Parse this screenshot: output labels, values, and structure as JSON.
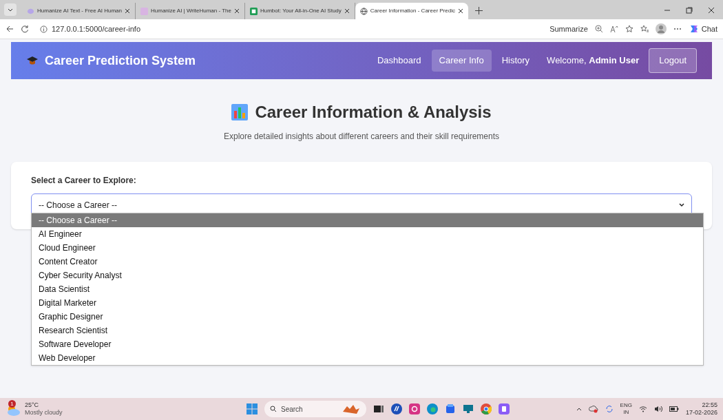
{
  "browser": {
    "tabs": [
      {
        "title": "Humanize AI Text - Free AI Human",
        "selected": false
      },
      {
        "title": "Humanize AI | WriteHuman - The",
        "selected": false
      },
      {
        "title": "Humbot: Your All-in-One AI Study",
        "selected": false
      },
      {
        "title": "Career Information - Career Predic",
        "selected": true
      }
    ],
    "address": "127.0.0.1:5000/career-info",
    "summarize": "Summarize",
    "chat": "Chat"
  },
  "header": {
    "brand": "Career Prediction System",
    "nav": [
      {
        "label": "Dashboard",
        "selected": false
      },
      {
        "label": "Career Info",
        "selected": true
      },
      {
        "label": "History",
        "selected": false
      }
    ],
    "welcome": "Welcome, **Admin User**",
    "logout": "Logout"
  },
  "page": {
    "title": "Career Information & Analysis",
    "subtitle": "Explore detailed insights about different careers and their skill requirements"
  },
  "career_select": {
    "label": "Select a Career to Explore:",
    "value": "-- Choose a Career --",
    "expanded": true,
    "options": [
      {
        "label": "-- Choose a Career --",
        "selected": true
      },
      {
        "label": "AI Engineer",
        "selected": false
      },
      {
        "label": "Cloud Engineer",
        "selected": false
      },
      {
        "label": "Content Creator",
        "selected": false
      },
      {
        "label": "Cyber Security Analyst",
        "selected": false
      },
      {
        "label": "Data Scientist",
        "selected": false
      },
      {
        "label": "Digital Marketer",
        "selected": false
      },
      {
        "label": "Graphic Designer",
        "selected": false
      },
      {
        "label": "Research Scientist",
        "selected": false
      },
      {
        "label": "Software Developer",
        "selected": false
      },
      {
        "label": "Web Developer",
        "selected": false
      }
    ]
  },
  "taskbar": {
    "weather": {
      "badge": "1",
      "temperature": "25°C",
      "condition": "Mostly cloudy"
    },
    "search_placeholder": "Search",
    "language": "ENG",
    "region": "IN",
    "time": "22:55",
    "date": "17-02-2026"
  }
}
